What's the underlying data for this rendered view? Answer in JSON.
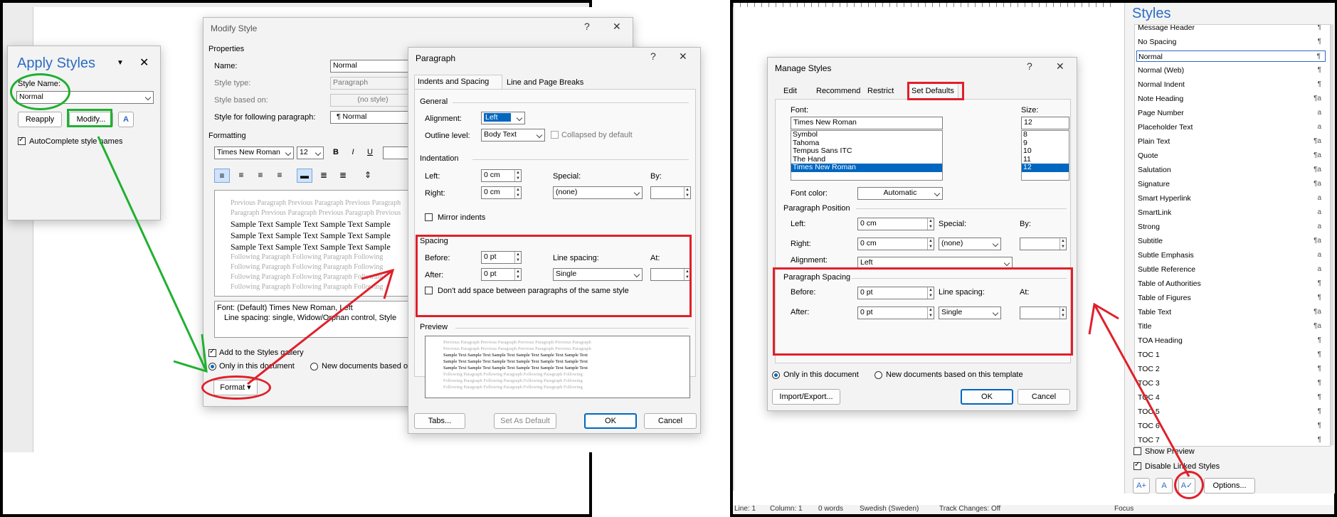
{
  "apply_styles": {
    "title": "Apply Styles",
    "style_name_label": "Style Name:",
    "style_name_value": "Normal",
    "reapply": "Reapply",
    "modify": "Modify...",
    "autocomplete": "AutoComplete style names"
  },
  "modify_style": {
    "title": "Modify Style",
    "properties": "Properties",
    "name_label": "Name:",
    "name_value": "Normal",
    "style_type_label": "Style type:",
    "style_type_value": "Paragraph",
    "based_on_label": "Style based on:",
    "based_on_value": "(no style)",
    "following_label": "Style for following paragraph:",
    "following_value": "¶ Normal",
    "formatting": "Formatting",
    "font": "Times New Roman",
    "size": "12",
    "bold": "B",
    "italic": "I",
    "underline": "U",
    "preview_prev_1": "Previous Paragraph Previous Paragraph Previous Paragraph",
    "preview_prev_2": "Paragraph Previous Paragraph Previous Paragraph Previous",
    "preview_sample": "Sample Text Sample Text Sample Text Sample",
    "preview_follow": "Following Paragraph Following Paragraph Following",
    "desc_1": "Font: (Default) Times New Roman, Left",
    "desc_2": "Line spacing:  single, Widow/Orphan control, Style",
    "add_gallery": "Add to the Styles gallery",
    "only_doc": "Only in this document",
    "new_docs": "New documents based o",
    "format": "Format"
  },
  "paragraph": {
    "title": "Paragraph",
    "tab_indents": "Indents and Spacing",
    "tab_breaks": "Line and Page Breaks",
    "general": "General",
    "alignment_label": "Alignment:",
    "alignment_value": "Left",
    "outline_label": "Outline level:",
    "outline_value": "Body Text",
    "collapsed": "Collapsed by default",
    "indentation": "Indentation",
    "left_label": "Left:",
    "left_value": "0 cm",
    "right_label": "Right:",
    "right_value": "0 cm",
    "special_label": "Special:",
    "special_value": "(none)",
    "by_label": "By:",
    "mirror": "Mirror indents",
    "spacing": "Spacing",
    "before_label": "Before:",
    "before_value": "0 pt",
    "after_label": "After:",
    "after_value": "0 pt",
    "line_spacing_label": "Line spacing:",
    "line_spacing_value": "Single",
    "at_label": "At:",
    "dont_add": "Don't add space between paragraphs of the same style",
    "preview": "Preview",
    "pv_prev": "Previous Paragraph Previous Paragraph Previous Paragraph Previous Paragraph",
    "pv_sample": "Sample Text Sample Text Sample Text Sample Text Sample Text Sample Text",
    "pv_follow": "Following Paragraph Following Paragraph Following Paragraph Following",
    "tabs": "Tabs...",
    "set_default": "Set As Default",
    "ok": "OK",
    "cancel": "Cancel"
  },
  "manage_styles": {
    "title": "Manage Styles",
    "tab_edit": "Edit",
    "tab_recommend": "Recommend",
    "tab_restrict": "Restrict",
    "tab_defaults": "Set Defaults",
    "font_label": "Font:",
    "font_value": "Times New Roman",
    "font_list": [
      "Symbol",
      "Tahoma",
      "Tempus Sans ITC",
      "The Hand",
      "Times New Roman"
    ],
    "size_label": "Size:",
    "size_value": "12",
    "size_list": [
      "8",
      "9",
      "10",
      "11",
      "12"
    ],
    "font_color_label": "Font color:",
    "font_color_value": "Automatic",
    "para_position": "Paragraph Position",
    "left_label": "Left:",
    "left_value": "0 cm",
    "right_label": "Right:",
    "right_value": "0 cm",
    "special_label": "Special:",
    "special_value": "(none)",
    "by_label": "By:",
    "alignment_label": "Alignment:",
    "alignment_value": "Left",
    "para_spacing": "Paragraph Spacing",
    "before_label": "Before:",
    "before_value": "0 pt",
    "after_label": "After:",
    "after_value": "0 pt",
    "line_spacing_label": "Line spacing:",
    "line_spacing_value": "Single",
    "at_label": "At:",
    "only_doc": "Only in this document",
    "new_docs": "New documents based on this template",
    "import_export": "Import/Export...",
    "ok": "OK",
    "cancel": "Cancel"
  },
  "styles_pane": {
    "title": "Styles",
    "items": [
      {
        "label": "Message Header",
        "mark": "¶"
      },
      {
        "label": "No Spacing",
        "mark": "¶"
      },
      {
        "label": "Normal",
        "mark": "¶"
      },
      {
        "label": "Normal (Web)",
        "mark": "¶"
      },
      {
        "label": "Normal Indent",
        "mark": "¶"
      },
      {
        "label": "Note Heading",
        "mark": "¶a"
      },
      {
        "label": "Page Number",
        "mark": "a"
      },
      {
        "label": "Placeholder Text",
        "mark": "a"
      },
      {
        "label": "Plain Text",
        "mark": "¶a"
      },
      {
        "label": "Quote",
        "mark": "¶a"
      },
      {
        "label": "Salutation",
        "mark": "¶a"
      },
      {
        "label": "Signature",
        "mark": "¶a"
      },
      {
        "label": "Smart Hyperlink",
        "mark": "a"
      },
      {
        "label": "SmartLink",
        "mark": "a"
      },
      {
        "label": "Strong",
        "mark": "a"
      },
      {
        "label": "Subtitle",
        "mark": "¶a"
      },
      {
        "label": "Subtle Emphasis",
        "mark": "a"
      },
      {
        "label": "Subtle Reference",
        "mark": "a"
      },
      {
        "label": "Table of Authorities",
        "mark": "¶"
      },
      {
        "label": "Table of Figures",
        "mark": "¶"
      },
      {
        "label": "Table Text",
        "mark": "¶a"
      },
      {
        "label": "Title",
        "mark": "¶a"
      },
      {
        "label": "TOA Heading",
        "mark": "¶"
      },
      {
        "label": "TOC 1",
        "mark": "¶"
      },
      {
        "label": "TOC 2",
        "mark": "¶"
      },
      {
        "label": "TOC 3",
        "mark": "¶"
      },
      {
        "label": "TOC 4",
        "mark": "¶"
      },
      {
        "label": "TOC 5",
        "mark": "¶"
      },
      {
        "label": "TOC 6",
        "mark": "¶"
      },
      {
        "label": "TOC 7",
        "mark": "¶"
      }
    ],
    "show_preview": "Show Preview",
    "disable_linked": "Disable Linked Styles",
    "options": "Options..."
  },
  "status_bar": {
    "line": "Line: 1",
    "column": "Column: 1",
    "words": "0 words",
    "language": "Swedish (Sweden)",
    "track": "Track Changes: Off",
    "focus": "Focus"
  },
  "colors": {
    "annotation_red": "#e0202a",
    "annotation_green": "#20b030",
    "accent": "#0067c0"
  }
}
